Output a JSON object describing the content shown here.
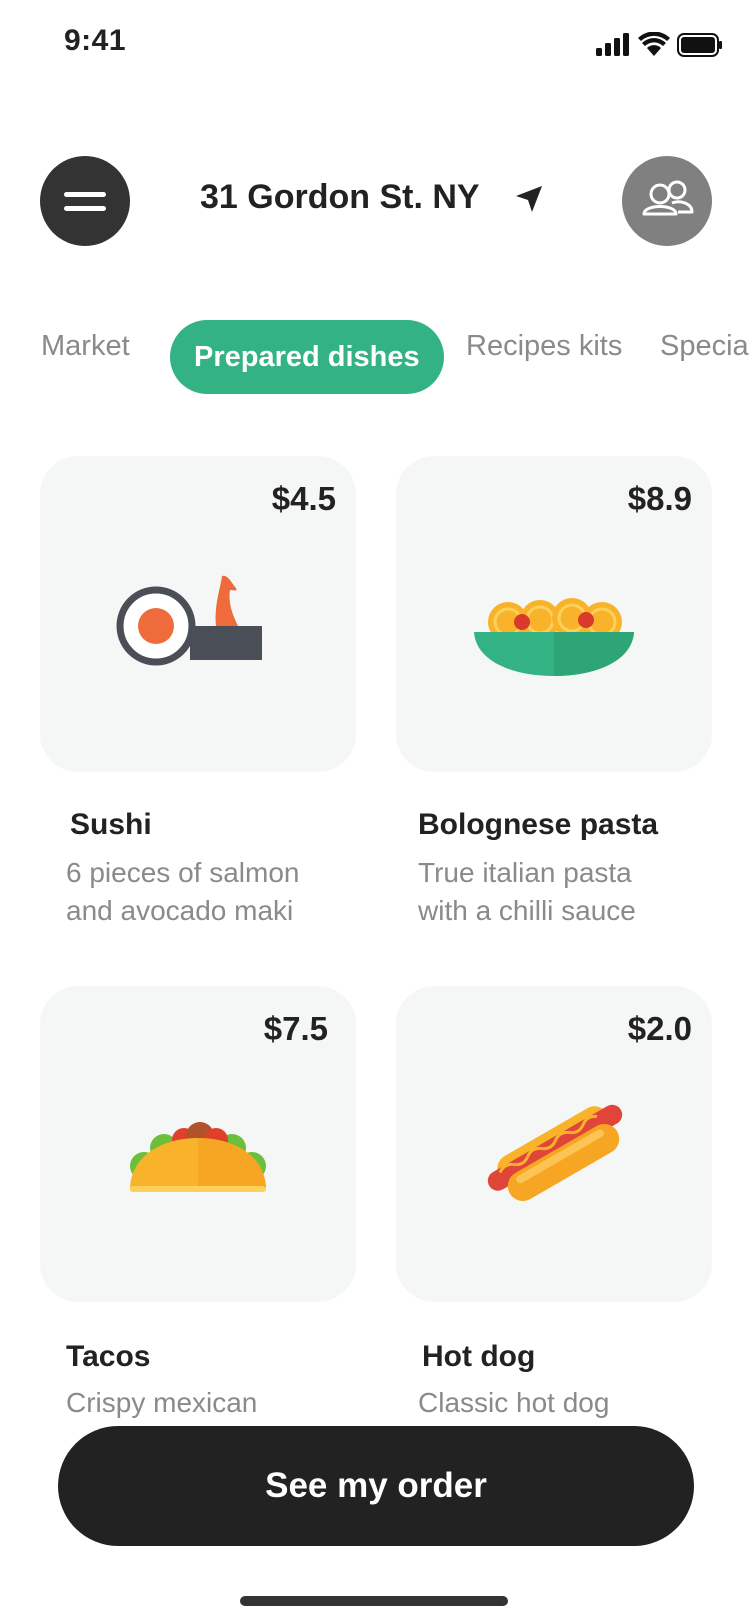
{
  "status_bar": {
    "time": "9:41"
  },
  "header": {
    "address": "31 Gordon St. NY",
    "menu_icon": "hamburger-icon",
    "location_icon": "location-arrow-icon",
    "profile_icon": "people-icon"
  },
  "tabs": [
    {
      "label": "Market",
      "active": false
    },
    {
      "label": "Prepared dishes",
      "active": true
    },
    {
      "label": "Recipes kits",
      "active": false
    },
    {
      "label": "Specia",
      "active": false
    }
  ],
  "dishes": [
    {
      "name": "Sushi",
      "price": "$4.5",
      "desc_line1": "6 pieces of salmon",
      "desc_line2": "and avocado maki",
      "icon": "sushi-icon"
    },
    {
      "name": "Bolognese pasta",
      "price": "$8.9",
      "desc_line1": "True italian pasta",
      "desc_line2": "with a chilli sauce",
      "icon": "pasta-icon"
    },
    {
      "name": "Tacos",
      "price": "$7.5",
      "desc_line1": "Crispy mexican",
      "desc_line2": "",
      "icon": "taco-icon"
    },
    {
      "name": "Hot dog",
      "price": "$2.0",
      "desc_line1": "Classic hot dog",
      "desc_line2": "",
      "icon": "hotdog-icon"
    }
  ],
  "order_button": {
    "label": "See my order"
  },
  "colors": {
    "accent": "#33b383",
    "dark": "#222222",
    "card_bg": "#f5f6f6",
    "muted_text": "#8a8a8a"
  }
}
